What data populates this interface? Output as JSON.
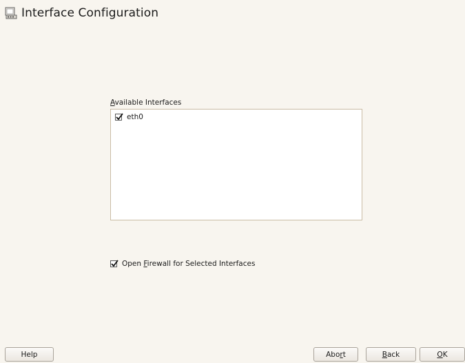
{
  "header": {
    "title": "Interface Configuration",
    "icon": "network-card-icon"
  },
  "interfaces": {
    "label_accel": "A",
    "label_rest": "vailable Interfaces",
    "items": [
      {
        "name": "eth0",
        "checked": true
      }
    ]
  },
  "firewall": {
    "checked": true,
    "label_pre": "Open ",
    "label_accel": "F",
    "label_post": "irewall for Selected Interfaces"
  },
  "buttons": {
    "help": "Help",
    "abort_pre": "Abo",
    "abort_accel": "r",
    "abort_post": "t",
    "back_accel": "B",
    "back_post": "ack",
    "ok_accel": "O",
    "ok_post": "K"
  },
  "colors": {
    "background": "#f8f5ef",
    "list_border": "#c9bba4"
  }
}
